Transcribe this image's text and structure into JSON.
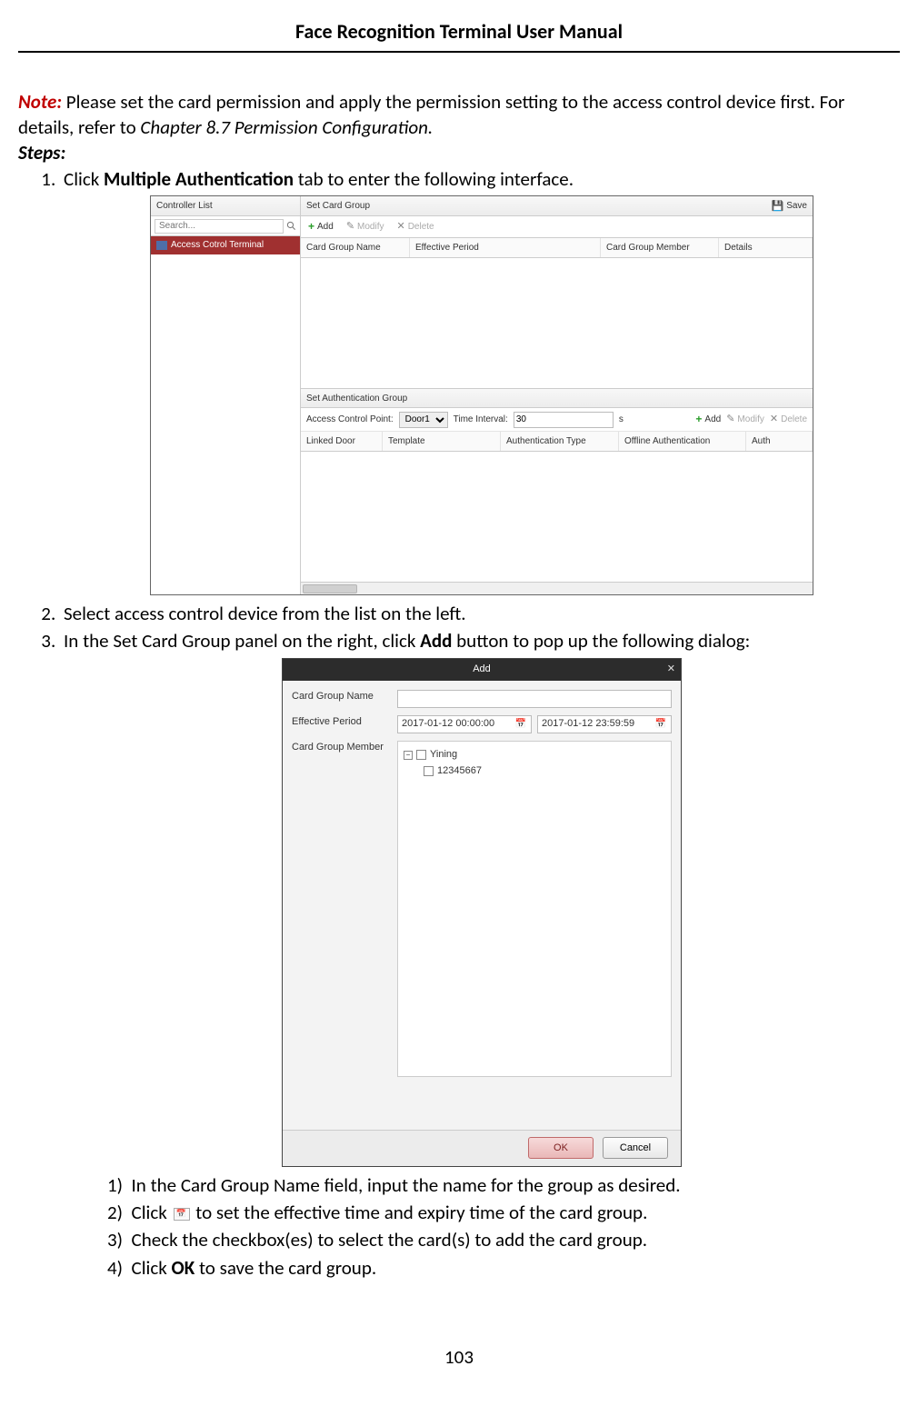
{
  "header": {
    "title_bold": "Face Recognition Terminal",
    "title_rest": " User Manual"
  },
  "page_number": "103",
  "note": {
    "label": "Note:",
    "text_a": " Please set the card permission and apply the permission setting to the access control device first. For details, refer to ",
    "chapter_ref": "Chapter 8.7 Permission Configuration.",
    "steps_label": "Steps:"
  },
  "steps": {
    "s1_a": "Click ",
    "s1_bold": "Multiple Authentication",
    "s1_b": " tab to enter the following interface.",
    "s2": "Select access control device from the list on the left.",
    "s3_a": "In the Set Card Group panel on the right, click ",
    "s3_bold": "Add",
    "s3_b": " button to pop up the following dialog:"
  },
  "substeps": {
    "ss1_num": "1)",
    "ss1": "In the Card Group Name field, input the name for the group as desired.",
    "ss2_num": "2)",
    "ss2_a": "Click ",
    "ss2_b": " to set the effective time and expiry time of the card group.",
    "ss3_num": "3)",
    "ss3": "Check the checkbox(es) to select the card(s) to add the card group.",
    "ss4_num": "4)",
    "ss4_a": "Click ",
    "ss4_bold": "OK",
    "ss4_b": " to save the card group."
  },
  "shot1": {
    "left_header": "Controller List",
    "search_placeholder": "Search...",
    "selected_item": "Access Cotrol Terminal",
    "card_group_header": "Set Card Group",
    "save_label": "Save",
    "add_label": "Add",
    "modify_label": "Modify",
    "delete_label": "Delete",
    "cols": {
      "c1": "Card Group Name",
      "c2": "Effective Period",
      "c3": "Card Group Member",
      "c4": "Details"
    },
    "auth_group_header": "Set Authentication Group",
    "acp_label": "Access Control Point:",
    "acp_value": "Door1",
    "interval_label": "Time Interval:",
    "interval_value": "30",
    "interval_unit": "s",
    "cols2": {
      "c1": "Linked Door",
      "c2": "Template",
      "c3": "Authentication Type",
      "c4": "Offline Authentication",
      "c5": "Auth"
    }
  },
  "shot2": {
    "title": "Add",
    "lbl_name": "Card Group Name",
    "lbl_period": "Effective Period",
    "lbl_member": "Card Group Member",
    "name_value": "",
    "period_from": "2017-01-12 00:00:00",
    "period_to": "2017-01-12 23:59:59",
    "tree_parent": "Yining",
    "tree_child": "12345667",
    "ok": "OK",
    "cancel": "Cancel"
  }
}
